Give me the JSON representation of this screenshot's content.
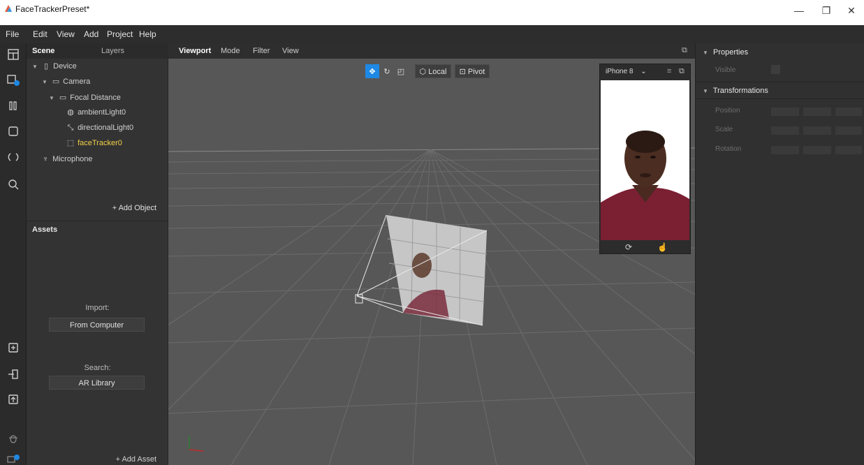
{
  "window": {
    "title": "FaceTrackerPreset*",
    "controls": [
      "—",
      "❐",
      "✕"
    ]
  },
  "menu": [
    "File",
    "Edit",
    "View",
    "Add",
    "Project",
    "Help"
  ],
  "scene_panel": {
    "tabs": [
      "Scene",
      "Layers"
    ],
    "tree": [
      {
        "label": "Device",
        "icon": "device-icon"
      },
      {
        "label": "Camera",
        "icon": "camera-icon"
      },
      {
        "label": "Focal Distance",
        "icon": "focal-distance-icon"
      },
      {
        "label": "ambientLight0",
        "icon": "ambient-light-icon"
      },
      {
        "label": "directionalLight0",
        "icon": "directional-light-icon"
      },
      {
        "label": "faceTracker0",
        "icon": "face-tracker-icon",
        "selected": true
      },
      {
        "label": "Microphone",
        "icon": "microphone-icon"
      }
    ],
    "add_object": "+ Add Object"
  },
  "assets_panel": {
    "title": "Assets",
    "import_label": "Import:",
    "import_button": "From Computer",
    "search_label": "Search:",
    "search_button": "AR Library",
    "add_asset": "+ Add Asset"
  },
  "viewport": {
    "tabs": [
      "Viewport",
      "Mode",
      "Filter",
      "View"
    ],
    "toolbar": {
      "local": "Local",
      "pivot": "Pivot"
    },
    "simulator": {
      "device": "iPhone 8"
    }
  },
  "properties": {
    "section_properties": "Properties",
    "visible_label": "Visible",
    "section_transformations": "Transformations",
    "position_label": "Position",
    "scale_label": "Scale",
    "rotation_label": "Rotation"
  },
  "colors": {
    "accent": "#1e88e5",
    "selected_text": "#f2d14a",
    "viewport_bg": "#565656"
  }
}
